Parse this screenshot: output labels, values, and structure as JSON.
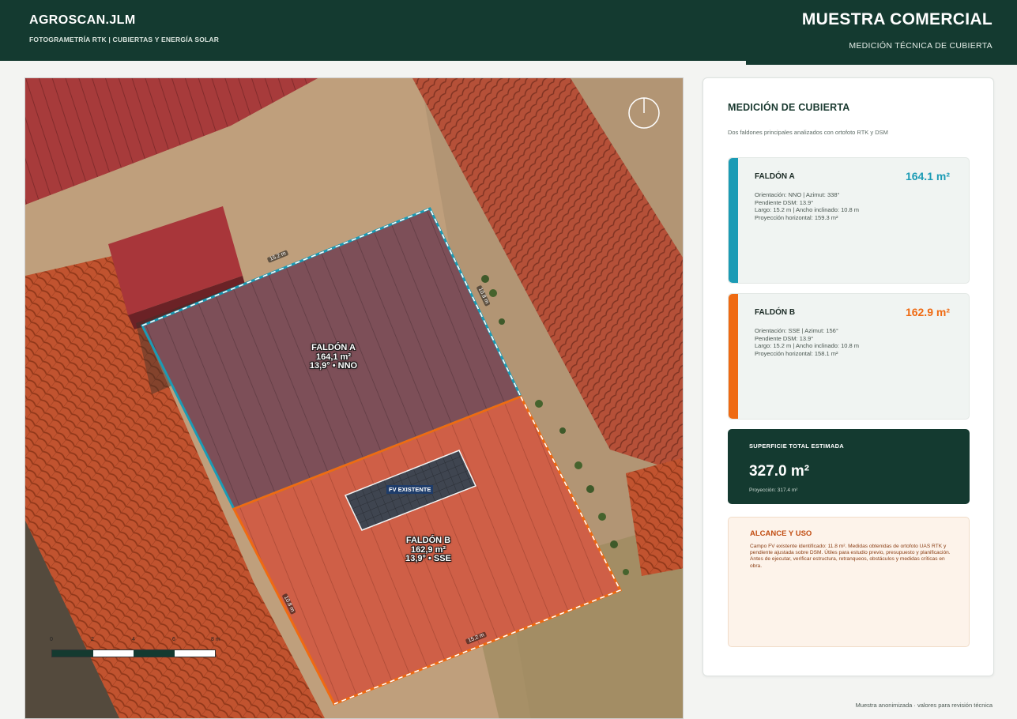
{
  "header": {
    "brand": "AGROSCAN.JLM",
    "subtitle": "FOTOGRAMETRÍA RTK  |  CUBIERTAS Y ENERGÍA SOLAR",
    "badge_title": "MUESTRA COMERCIAL",
    "badge_subtitle": "MEDICIÓN TÉCNICA DE CUBIERTA"
  },
  "map": {
    "faldon_a": {
      "name": "FALDÓN A",
      "area": "164,1 m²",
      "slope": "13,9°  •  NNO"
    },
    "faldon_b": {
      "name": "FALDÓN B",
      "area": "162,9 m²",
      "slope": "13,9°  •  SSE"
    },
    "pv_label": "FV EXISTENTE",
    "dimensions": {
      "a_top": "15.2 m",
      "a_side": "10.8 m",
      "b_side": "10.8 m",
      "b_bottom": "15.2 m"
    },
    "scale": {
      "labels": [
        "0",
        "2",
        "4",
        "6",
        "8 m"
      ]
    },
    "colors": {
      "faldon_a": "#1b9bb5",
      "faldon_b": "#ef6a12"
    }
  },
  "panel": {
    "title": "MEDICIÓN DE CUBIERTA",
    "subtitle": "Dos faldones principales analizados con ortofoto RTK y DSM",
    "cards": [
      {
        "name": "FALDÓN A",
        "area": "164.1 m²",
        "color": "#1b9bb5",
        "lines": [
          "Orientación: NNO  |  Azimut: 338°",
          "Pendiente DSM: 13.9°",
          "Largo: 15.2 m  |  Ancho inclinado: 10.8 m",
          "Proyección horizontal: 159.3 m²"
        ]
      },
      {
        "name": "FALDÓN B",
        "area": "162.9 m²",
        "color": "#ef6a12",
        "lines": [
          "Orientación: SSE  |  Azimut: 156°",
          "Pendiente DSM: 13.9°",
          "Largo: 15.2 m  |  Ancho inclinado: 10.8 m",
          "Proyección horizontal: 158.1 m²"
        ]
      }
    ],
    "total": {
      "label": "SUPERFICIE TOTAL ESTIMADA",
      "value": "327.0 m²",
      "projection": "Proyección: 317.4 m²"
    },
    "scope": {
      "title": "ALCANCE Y USO",
      "text": "Campo FV existente identificado: 11.8 m². Medidas obtenidas de ortofoto UAS RTK y pendiente ajustada sobre DSM. Útiles para estudio previo, presupuesto y planificación. Antes de ejecutar, verificar estructura, retranqueos, obstáculos y medidas críticas en obra."
    }
  },
  "footer": {
    "note": "Muestra anonimizada · valores para revisión técnica"
  }
}
